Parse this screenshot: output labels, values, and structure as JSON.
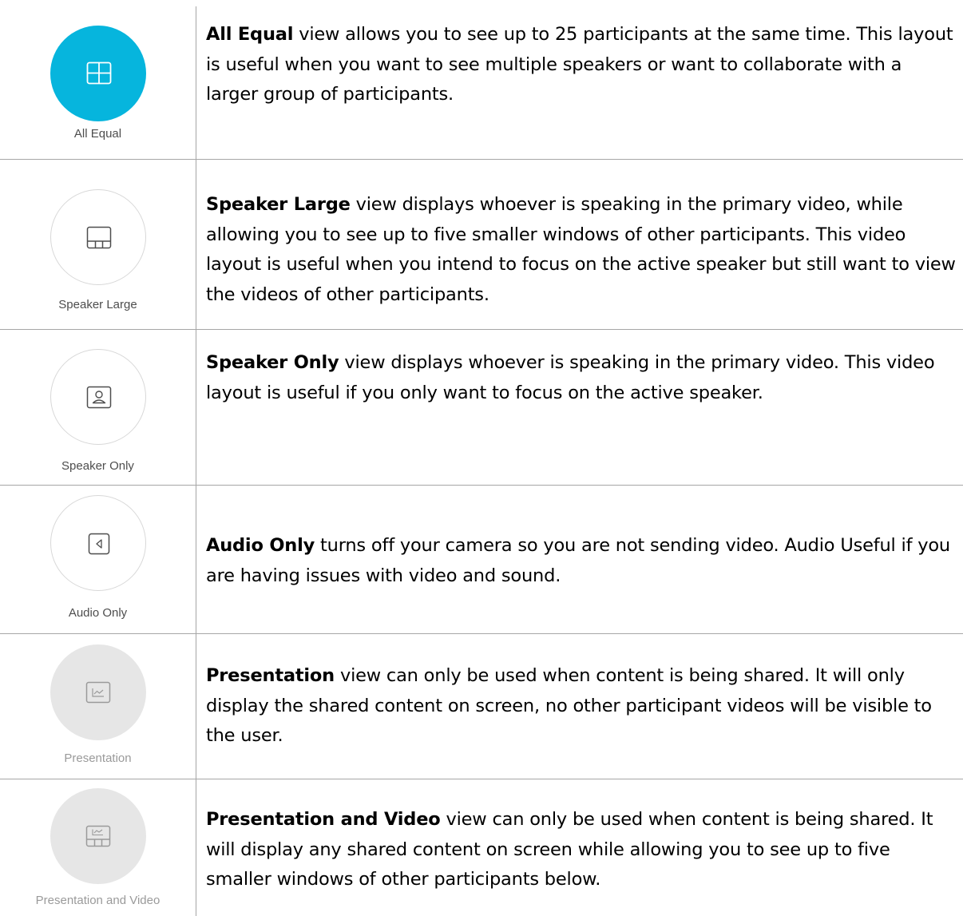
{
  "rows": [
    {
      "label": "All Equal",
      "title": "All Equal",
      "body": " view allows you to see up to 25 participants at the same time. This layout is useful when you want to see multiple speakers or want to collaborate with a larger group of participants.",
      "icon": "grid-icon",
      "state": "active"
    },
    {
      "label": "Speaker Large",
      "title": "Speaker Large",
      "body": " view displays whoever is speaking in the primary video, while allowing you to see up to five smaller windows of other participants. This video layout is useful when you intend to focus on the active speaker but still want to view the videos of other participants.",
      "icon": "speaker-large-layout-icon",
      "state": "normal"
    },
    {
      "label": "Speaker Only",
      "title": "Speaker Only",
      "body": " view displays whoever is speaking in the primary video. This video layout is useful if you only want to focus on the active speaker.",
      "icon": "person-icon",
      "state": "normal"
    },
    {
      "label": "Audio Only",
      "title": "Audio Only",
      "body": " turns off your camera so you are not sending video. Audio Useful if you are having issues with video and sound.",
      "icon": "speaker-icon",
      "state": "normal"
    },
    {
      "label": "Presentation",
      "title": "Presentation",
      "body": " view can only be used when content is being shared. It will only display the shared content on screen, no other participant videos will be visible to the user.",
      "icon": "chart-icon",
      "state": "disabled"
    },
    {
      "label": "Presentation and Video",
      "title": "Presentation and Video",
      "body": " view can only be used when content is being shared. It will display any shared content on screen while allowing you to see up to five smaller windows of other participants below.",
      "icon": "presentation-video-layout-icon",
      "state": "disabled"
    }
  ],
  "colors": {
    "active": "#06b5dd",
    "border": "#a6a6a6",
    "disabled_fill": "#e6e6e6"
  }
}
